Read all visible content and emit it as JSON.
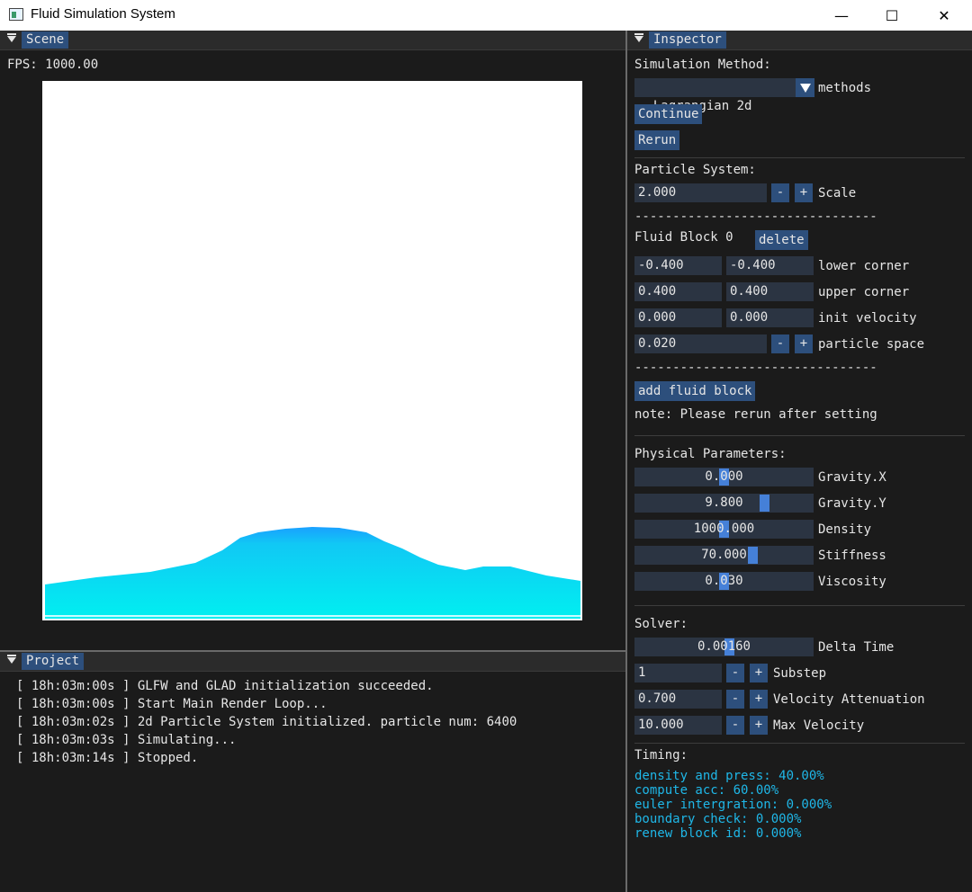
{
  "window": {
    "title": "Fluid Simulation System",
    "buttons": {
      "minimize": "—",
      "maximize": "☐",
      "close": "✕"
    }
  },
  "scene": {
    "tab_label": "Scene",
    "fps_text": "FPS: 1000.00",
    "particle_num": 6400,
    "background": "#ffffff",
    "fluid_colors": [
      "#00f0f0",
      "#1aa0ff"
    ]
  },
  "project": {
    "tab_label": "Project",
    "log": [
      "[ 18h:03m:00s ] GLFW and GLAD initialization succeeded.",
      "[ 18h:03m:00s ] Start Main Render Loop...",
      "[ 18h:03m:02s ] 2d Particle System initialized. particle num: 6400",
      "[ 18h:03m:03s ] Simulating...",
      "[ 18h:03m:14s ] Stopped."
    ]
  },
  "inspector": {
    "tab_label": "Inspector",
    "sim_method_label": "Simulation Method:",
    "method_value": "Lagrangian 2d",
    "methods_label": "methods",
    "continue_label": "Continue",
    "rerun_label": "Rerun",
    "particle_system_label": "Particle System:",
    "scale_value": "2.000",
    "scale_label": "Scale",
    "minus": "-",
    "plus": "+",
    "divider": "--------------------------------",
    "fluid_block_label": "Fluid Block 0",
    "delete_label": "delete",
    "lower_corner": {
      "x": "-0.400",
      "y": "-0.400",
      "label": "lower corner"
    },
    "upper_corner": {
      "x": "0.400",
      "y": "0.400",
      "label": "upper corner"
    },
    "init_velocity": {
      "x": "0.000",
      "y": "0.000",
      "label": "init velocity"
    },
    "particle_space": {
      "value": "0.020",
      "label": "particle space"
    },
    "add_fluid_block_label": "add fluid block",
    "note": "note: Please rerun after setting",
    "physical_label": "Physical Parameters:",
    "physical": [
      {
        "value": "0.000",
        "label": "Gravity.X",
        "level": 0.5
      },
      {
        "value": "9.800",
        "label": "Gravity.Y",
        "level": 0.75
      },
      {
        "value": "1000.000",
        "label": "Density",
        "level": 0.5
      },
      {
        "value": "70.000",
        "label": "Stiffness",
        "level": 0.67
      },
      {
        "value": "0.030",
        "label": "Viscosity",
        "level": 0.5
      }
    ],
    "solver_label": "Solver:",
    "delta_time": {
      "value": "0.00160",
      "label": "Delta Time",
      "level": 0.53
    },
    "substep": {
      "value": "1",
      "label": "Substep"
    },
    "velocity_attenuation": {
      "value": "0.700",
      "label": "Velocity Attenuation"
    },
    "max_velocity": {
      "value": "10.000",
      "label": "Max Velocity"
    },
    "timing_label": "Timing:",
    "timing": [
      "density and press: 40.00%",
      "compute acc: 60.00%",
      "euler intergration: 0.000%",
      "boundary check: 0.000%",
      "renew block id: 0.000%"
    ],
    "accent_color": "#2d4f7c",
    "timing_color": "#1fb7e8"
  }
}
